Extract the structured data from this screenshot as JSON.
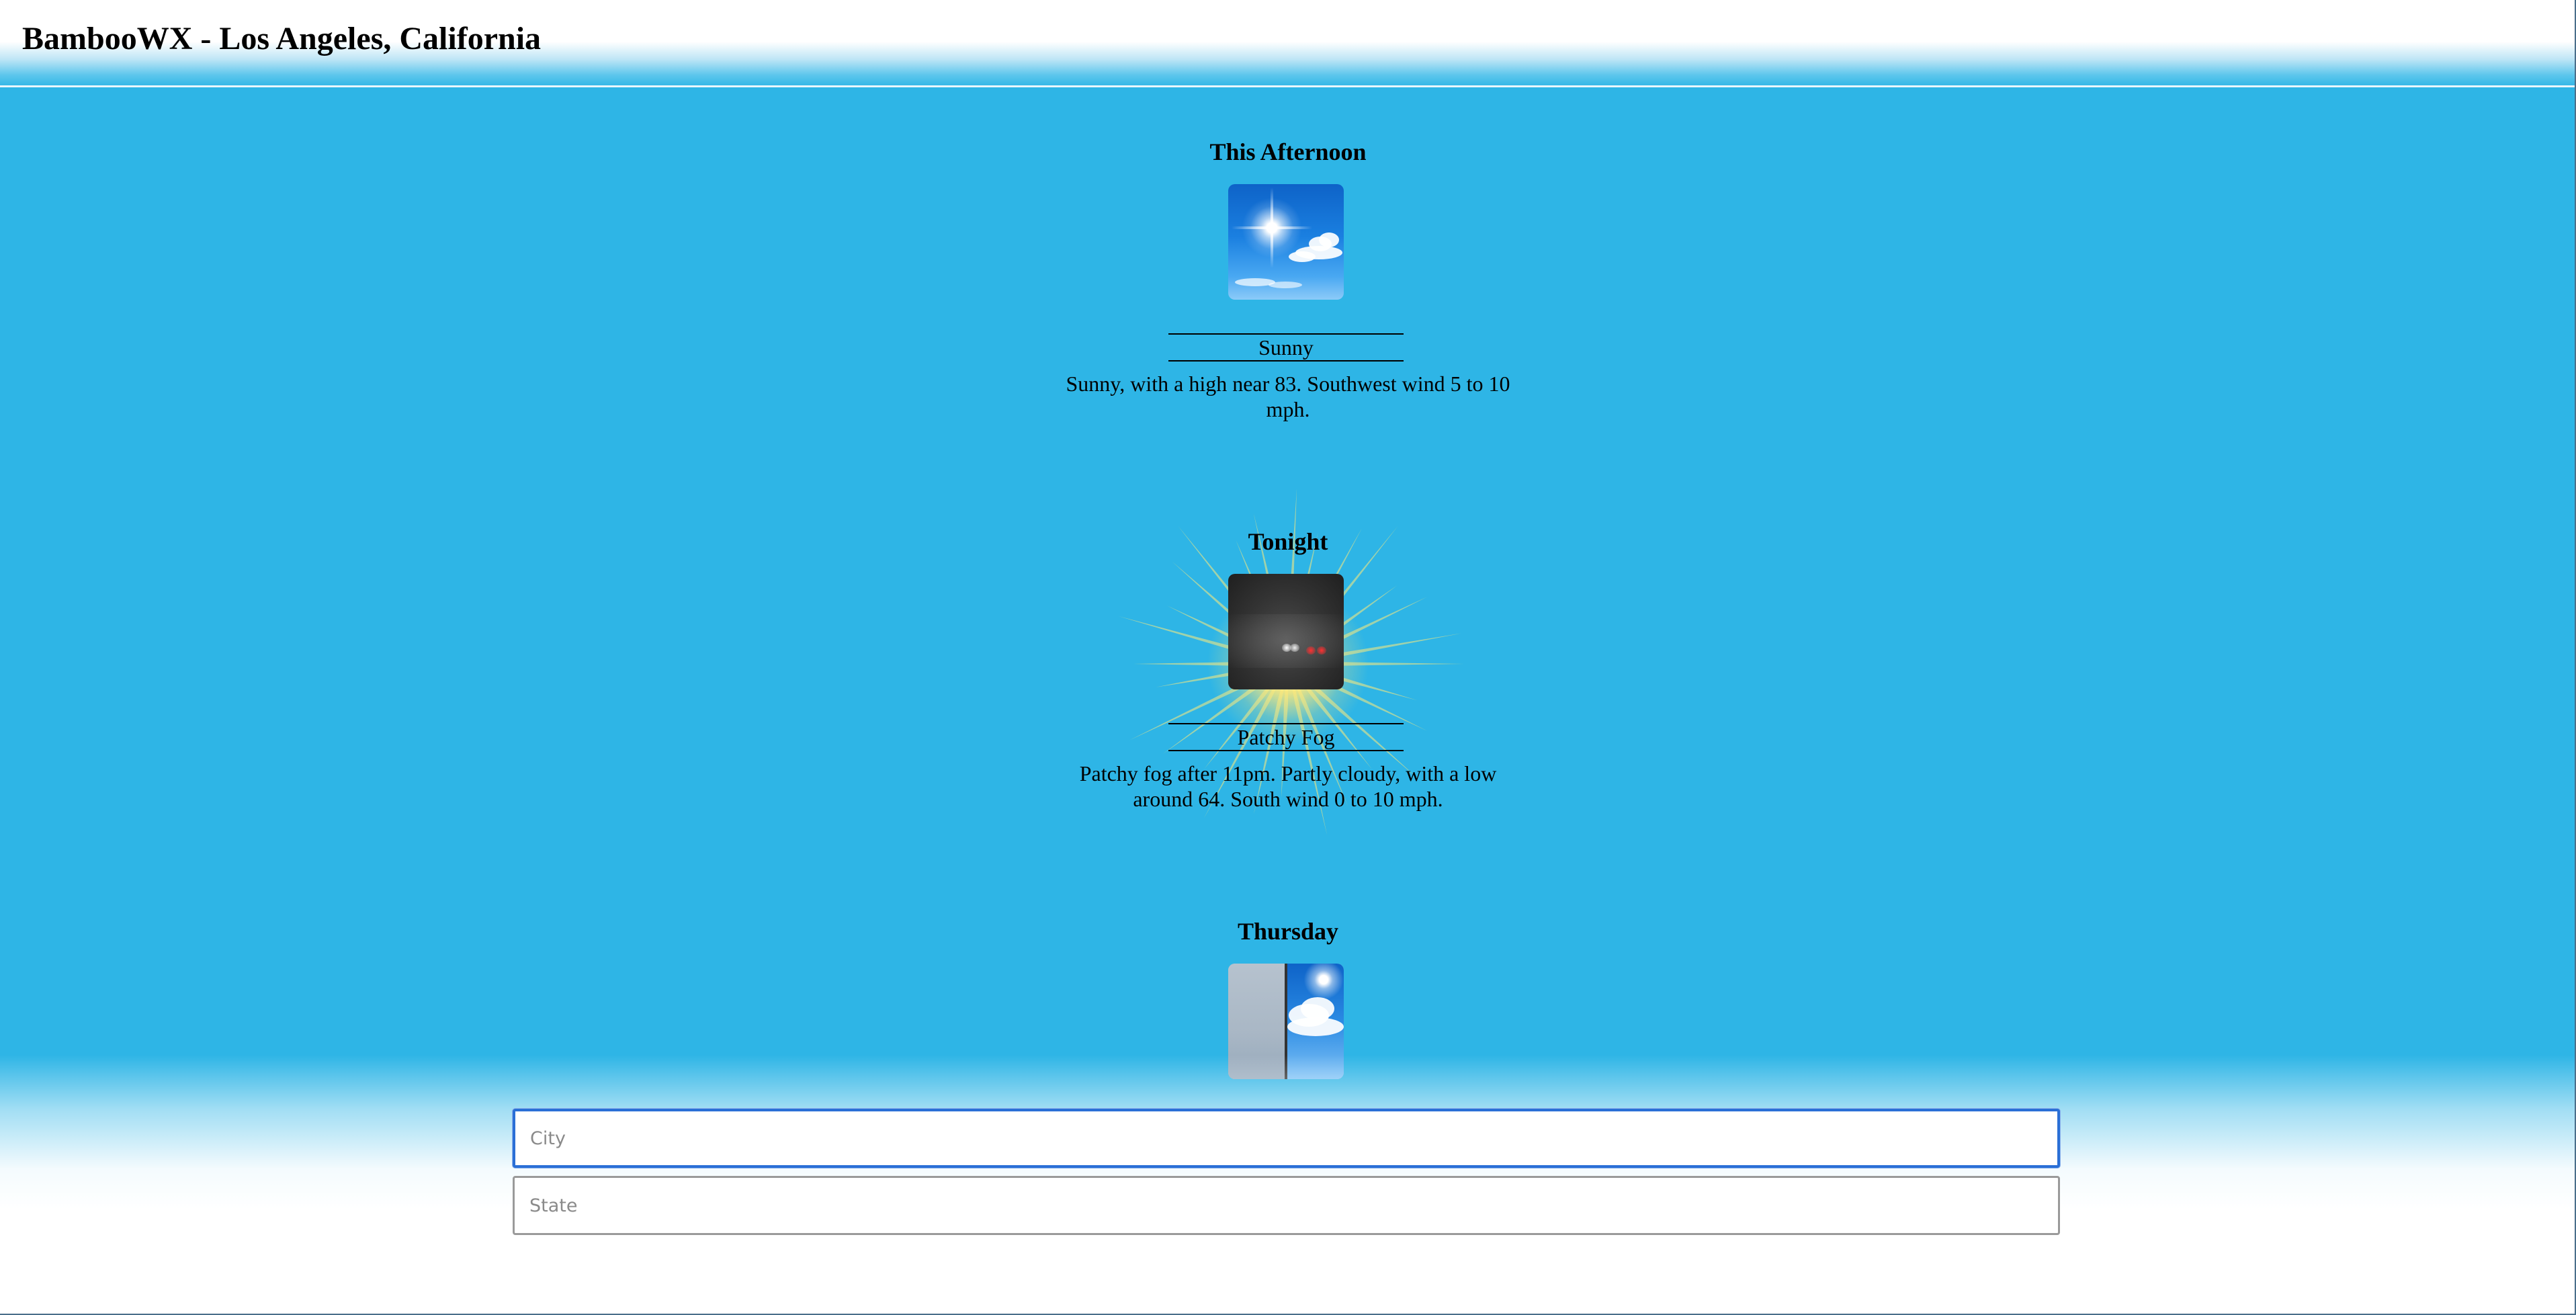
{
  "header": {
    "title": "BambooWX - Los Angeles, California"
  },
  "periods": [
    {
      "name": "This Afternoon",
      "icon": "sunny-icon",
      "short": "Sunny",
      "detail": "Sunny, with a high near 83. Southwest wind 5 to 10 mph."
    },
    {
      "name": "Tonight",
      "icon": "patchy-fog-icon",
      "short": "Patchy Fog",
      "detail": "Patchy fog after 11pm. Partly cloudy, with a low around 64. South wind 0 to 10 mph."
    },
    {
      "name": "Thursday",
      "icon": "fog-then-sunny-icon"
    }
  ],
  "search": {
    "city_placeholder": "City",
    "state_placeholder": "State"
  },
  "colors": {
    "background": "#2eb5e6",
    "focus_border": "#2a6fd6"
  }
}
